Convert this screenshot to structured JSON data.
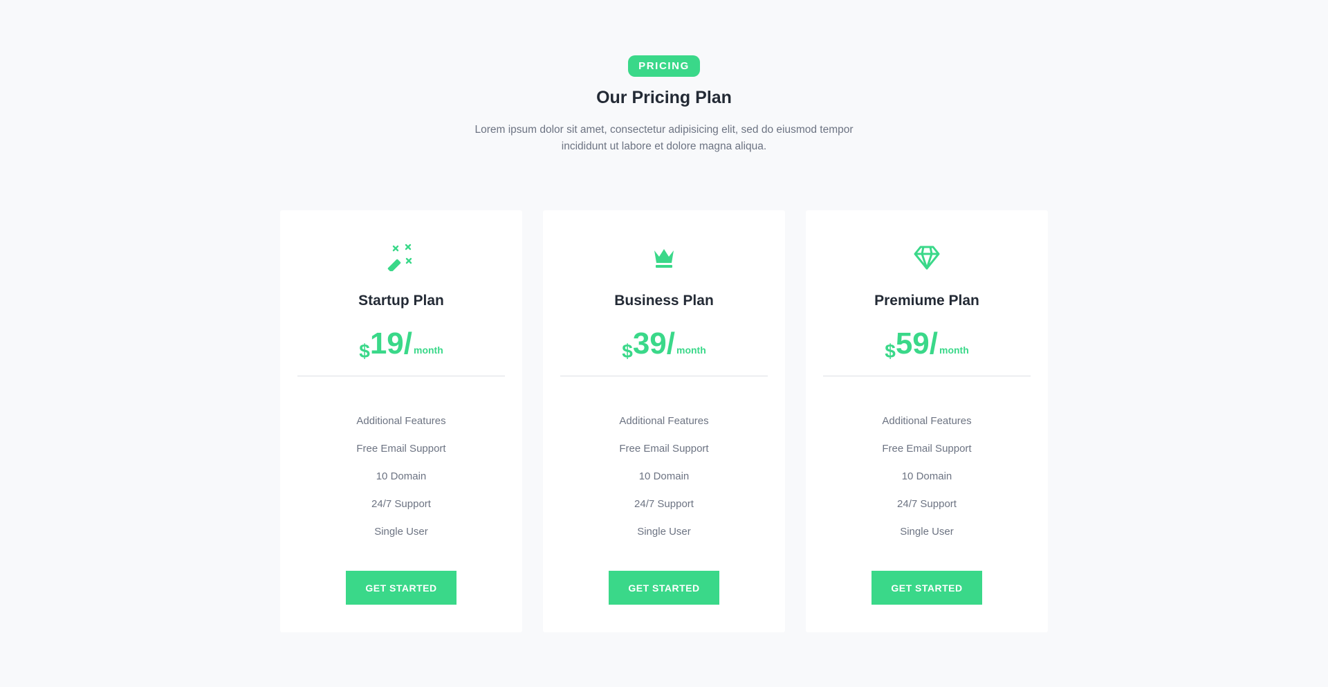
{
  "section": {
    "badge": "PRICING",
    "title": "Our Pricing Plan",
    "description": "Lorem ipsum dolor sit amet, consectetur adipisicing elit, sed do eiusmod tempor incididunt ut labore et dolore magna aliqua."
  },
  "colors": {
    "accent": "#3ad889",
    "heading": "#232a35",
    "body_text": "#6c7382",
    "background": "#f8f9fb",
    "card": "#ffffff"
  },
  "plans": [
    {
      "icon": "magic-wand-icon",
      "name": "Startup Plan",
      "currency": "$",
      "amount": "19",
      "slash": "/",
      "period": "month",
      "features": [
        "Additional Features",
        "Free Email Support",
        "10 Domain",
        "24/7 Support",
        "Single User"
      ],
      "cta": "GET STARTED"
    },
    {
      "icon": "crown-icon",
      "name": "Business Plan",
      "currency": "$",
      "amount": "39",
      "slash": "/",
      "period": "month",
      "features": [
        "Additional Features",
        "Free Email Support",
        "10 Domain",
        "24/7 Support",
        "Single User"
      ],
      "cta": "GET STARTED"
    },
    {
      "icon": "diamond-icon",
      "name": "Premiume Plan",
      "currency": "$",
      "amount": "59",
      "slash": "/",
      "period": "month",
      "features": [
        "Additional Features",
        "Free Email Support",
        "10 Domain",
        "24/7 Support",
        "Single User"
      ],
      "cta": "GET STARTED"
    }
  ]
}
